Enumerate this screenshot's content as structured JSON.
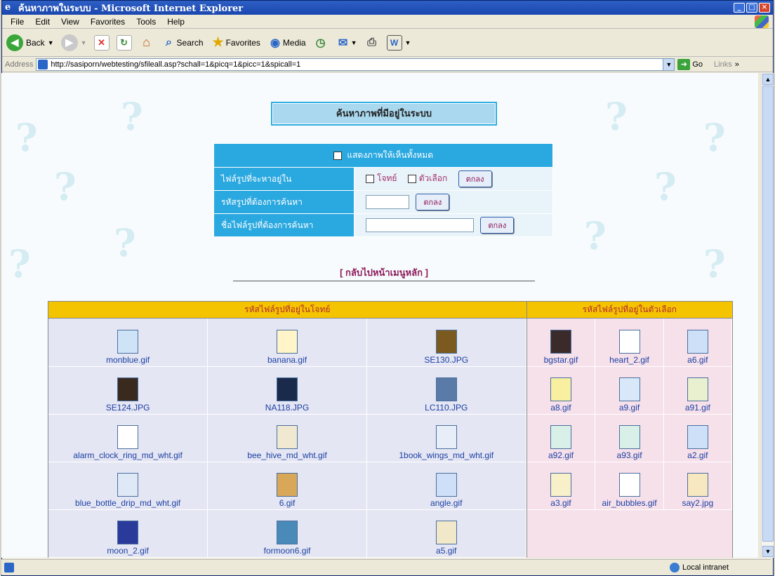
{
  "window": {
    "title": "ค้นหาภาพในระบบ - Microsoft Internet Explorer"
  },
  "menu": [
    "File",
    "Edit",
    "View",
    "Favorites",
    "Tools",
    "Help"
  ],
  "toolbar": {
    "back": "Back",
    "search": "Search",
    "favorites": "Favorites",
    "media": "Media"
  },
  "address": {
    "label": "Address",
    "url": "http://sasiporn/webtesting/sfileall.asp?schall=1&picq=1&picc=1&spicall=1",
    "go": "Go",
    "links": "Links"
  },
  "status": {
    "zone": "Local intranet"
  },
  "page": {
    "heading": "ค้นหาภาพที่มีอยู่ในระบบ",
    "show_all_label": "แสดงภาพให้เห็นทั้งหมด",
    "row1_label": "ไฟล์รูปที่จะหาอยู่ใน",
    "row1_opt1": "โจทย์",
    "row1_opt2": "ตัวเลือก",
    "row2_label": "รหัสรูปที่ต้องการค้นหา",
    "row3_label": "ชื่อไฟล์รูปที่ต้องการค้นหา",
    "ok": "ตกลง",
    "back_link": "[ กลับไปหน้าเมนูหลัก ]"
  },
  "grid": {
    "left_header": "รหัสไฟล์รูปที่อยู่ในโจทย์",
    "right_header": "รหัสไฟล์รูปที่อยู่ในตัวเลือก",
    "left": [
      "monblue.gif",
      "banana.gif",
      "SE130.JPG",
      "SE124.JPG",
      "NA118.JPG",
      "LC110.JPG",
      "alarm_clock_ring_md_wht.gif",
      "bee_hive_md_wht.gif",
      "1book_wings_md_wht.gif",
      "blue_bottle_drip_md_wht.gif",
      "6.gif",
      "angle.gif",
      "moon_2.gif",
      "formoon6.gif",
      "a5.gif"
    ],
    "right": [
      "bgstar.gif",
      "heart_2.gif",
      "a6.gif",
      "a8.gif",
      "a9.gif",
      "a91.gif",
      "a92.gif",
      "a93.gif",
      "a2.gif",
      "a3.gif",
      "air_bubbles.gif",
      "say2.jpg"
    ]
  }
}
